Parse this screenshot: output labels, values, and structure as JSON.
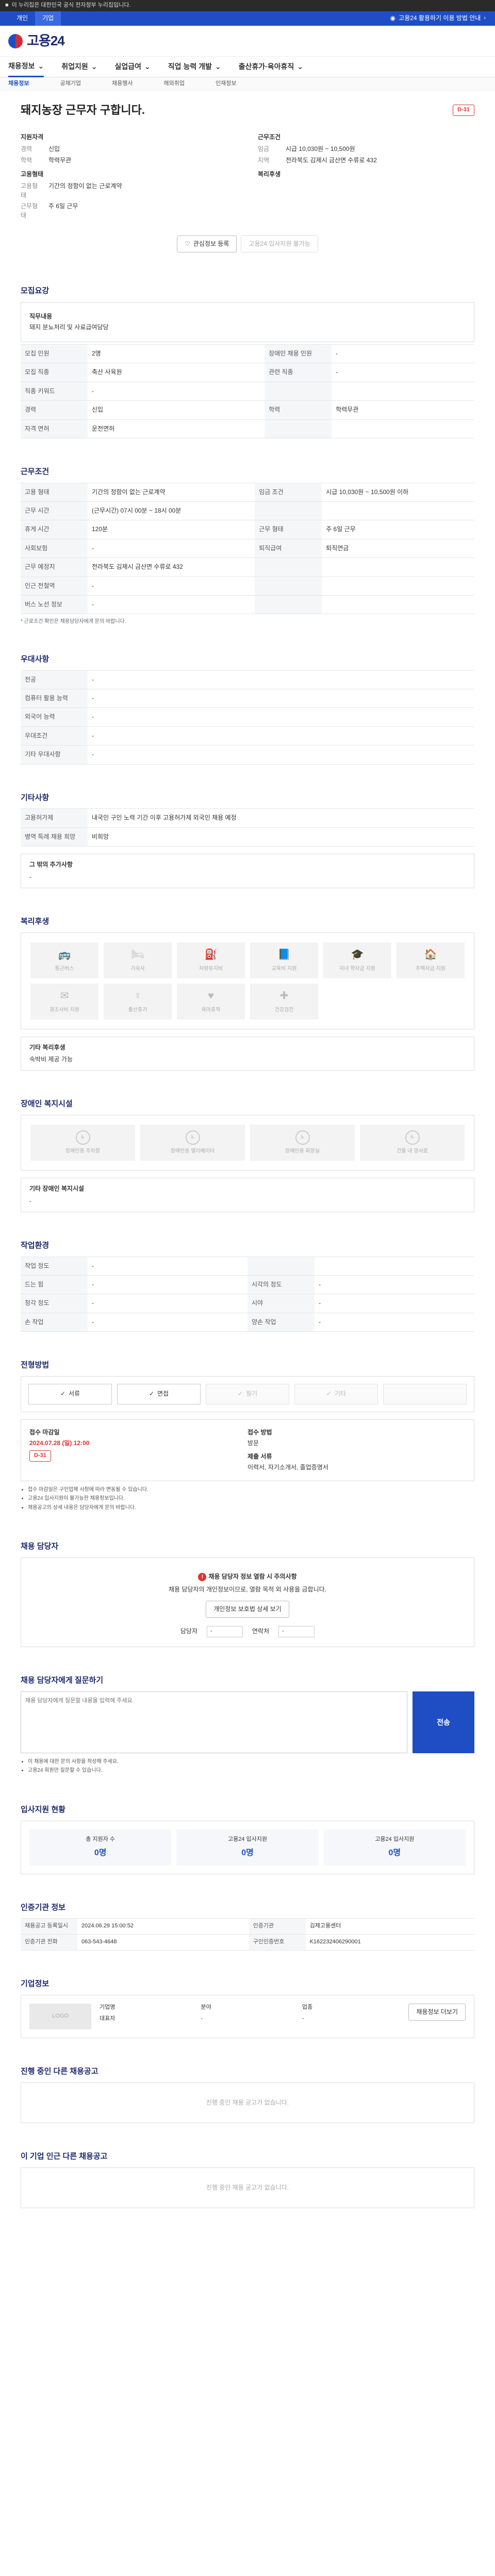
{
  "topbar": {
    "text": "이 누리집은 대한민국 공식 전자정부 누리집입니다."
  },
  "govbar": {
    "tabs": [
      "개인",
      "기업"
    ],
    "right": "고용24 활용하기 이용 방법 안내"
  },
  "brand": {
    "name": "고용24"
  },
  "gnb": {
    "items": [
      "채용정보",
      "취업지원",
      "실업급여",
      "직업 능력 개발",
      "출산휴가·육아휴직"
    ]
  },
  "subnav": {
    "items": [
      "채용정보",
      "공채기업",
      "채용행사",
      "해외취업",
      "인재정보"
    ]
  },
  "job": {
    "title": "돼지농장 근무자 구합니다.",
    "badge": "D-31",
    "left": {
      "h1": "지원자격",
      "career_k": "경력",
      "career_v": "신입",
      "edu_k": "학력",
      "edu_v": "학력무관",
      "h2": "고용형태",
      "type_k": "고용형태",
      "type_v": "기간의 정함이 없는 근로계약",
      "hours_k": "근무형태",
      "hours_v": "주 6일 근무"
    },
    "right": {
      "h1": "근무조건",
      "pay_k": "임금",
      "pay_v": "시급 10,030원 ~ 10,500원",
      "loc_k": "지역",
      "loc_v": "전라북도 김제시 금산면 수류로 432",
      "h2": "복리후생"
    },
    "btn_interest": "관심정보 등록",
    "btn_apply": "고용24 입사지원 불가능"
  },
  "recruit": {
    "title": "모집요강",
    "panel_title": "직무내용",
    "panel_text": "돼지 분뇨처리 및 사료급여담당",
    "rows": [
      [
        "모집 인원",
        "2명",
        "장애인 채용 인원",
        "-"
      ],
      [
        "모집 직종",
        "축산 사육원",
        "관련 직종",
        "-"
      ],
      [
        "직종 키워드",
        "-",
        "",
        ""
      ],
      [
        "경력",
        "신입",
        "학력",
        "학력무관"
      ],
      [
        "자격 면허",
        "운전면허",
        "",
        ""
      ]
    ]
  },
  "conditions": {
    "title": "근무조건",
    "rows": [
      [
        "고용 형태",
        "기간의 정함이 없는 근로계약",
        "임금 조건",
        "시급 10,030원 ~ 10,500원 이하"
      ],
      [
        "근무 시간",
        "(근무시간) 07시 00분 ~ 18시 00분",
        "",
        ""
      ],
      [
        "휴게 시간",
        "120분",
        "근무 형태",
        "주 6일 근무"
      ],
      [
        "사회보험",
        "-",
        "퇴직급여",
        "퇴직연금"
      ],
      [
        "근무 예정지",
        "전라북도 김제시 금산면 수류로 432",
        "",
        ""
      ],
      [
        "인근 전철역",
        "-",
        "",
        ""
      ],
      [
        "버스 노선 정보",
        "-",
        "",
        ""
      ]
    ],
    "note": "* 근로조건 확인은 채용담당자에게 문의 바랍니다."
  },
  "preference": {
    "title": "우대사항",
    "rows": [
      [
        "전공",
        "-"
      ],
      [
        "컴퓨터 활용 능력",
        "-"
      ],
      [
        "외국어 능력",
        "-"
      ],
      [
        "우대조건",
        "-"
      ],
      [
        "기타 우대사항",
        "-"
      ]
    ]
  },
  "etc": {
    "title": "기타사항",
    "rows": [
      [
        "고용허가제",
        "내국인 구인 노력 기간 이후 고용허가제 외국인 채용 예정"
      ],
      [
        "병역 특례 채용 희망",
        "비희망"
      ]
    ],
    "panel_title": "그 밖의 추가사항",
    "panel_text": "-"
  },
  "welfare": {
    "title": "복리후생",
    "items": [
      "통근버스",
      "기숙사",
      "차량유지비",
      "교육비 지원",
      "자녀 학자금 지원",
      "주택자금 지원",
      "경조사비 지원",
      "출산휴가",
      "육아휴직",
      "건강검진"
    ],
    "panel_title": "기타 복리후생",
    "panel_text": "숙박비 제공 가능"
  },
  "disability": {
    "title": "장애인 복지시설",
    "items": [
      "장애인용 주차장",
      "장애인용 엘리베이터",
      "장애인용 화장실",
      "건물 내 경사로"
    ],
    "panel_title": "기타 장애인 복지시설",
    "panel_text": "-"
  },
  "env": {
    "title": "작업환경",
    "rows": [
      [
        "작업 정도",
        "-",
        "",
        ""
      ],
      [
        "드는 힘",
        "-",
        "시각의 정도",
        "-"
      ],
      [
        "청각 정도",
        "-",
        "시야",
        "-"
      ],
      [
        "손 작업",
        "-",
        "양손 작업",
        "-"
      ]
    ]
  },
  "method": {
    "title": "전형방법",
    "items": [
      "서류",
      "면접",
      "필기",
      "기타"
    ],
    "period_k": "접수 마감일",
    "period_v": "2024.07.28 (일) 12:00",
    "period_badge": "D-31",
    "method_k": "접수 방법",
    "method_v": "방문",
    "doc_k": "제출 서류",
    "doc_v": "이력서, 자기소개서, 졸업증명서",
    "notes": [
      "접수 마감일은 구인업체 사정에 따라 변동될 수 있습니다.",
      "고용24 입사지원이 불가능한 채용정보입니다.",
      "채용공고의 상세 내용은 담당자에게 문의 바랍니다."
    ]
  },
  "manager": {
    "title": "채용 담당자",
    "alert": "채용 담당자 정보 열람 시 주의사항",
    "msg": "채용 담당자의 개인정보이므로, 열람 목적 외 사용을 금합니다.",
    "btn": "개인정보 보호법 상세 보기",
    "f1": "담당자",
    "f2": "연락처"
  },
  "inquiry": {
    "title": "채용 담당자에게 질문하기",
    "placeholder": "채용 담당자에게 질문할 내용을 입력해 주세요.",
    "send": "전송",
    "notes": [
      "이 채용에 대한 문의 사항을 작성해 주세요.",
      "고용24 회원만 질문할 수 있습니다."
    ]
  },
  "status": {
    "title": "입사지원 현황",
    "items": [
      [
        "총 지원자 수",
        "0명"
      ],
      [
        "고용24 입사지원",
        "0명"
      ],
      [
        "고용24 입사지원",
        "0명"
      ]
    ]
  },
  "agency": {
    "title": "인증기관 정보",
    "rows": [
      [
        "채용공고 등록일시",
        "2024.06.29 15:00:52",
        "인증기관",
        "김제고용센터"
      ],
      [
        "인증기관 전화",
        "063-543-4648",
        "구인인증번호",
        "K162232406290001"
      ]
    ]
  },
  "company": {
    "title": "기업정보",
    "logo": "LOGO",
    "rows": [
      [
        "기업명",
        "분야",
        "업종"
      ],
      [
        "대표자",
        "-",
        "-"
      ]
    ],
    "btn": "채용정보 더보기"
  },
  "related": {
    "title": "진행 중인 다른 채용공고",
    "empty": "진행 중인 채용 공고가 없습니다."
  },
  "nearby": {
    "title": "이 기업 인근 다른 채용공고",
    "empty": "진행 중인 채용 공고가 없습니다."
  }
}
